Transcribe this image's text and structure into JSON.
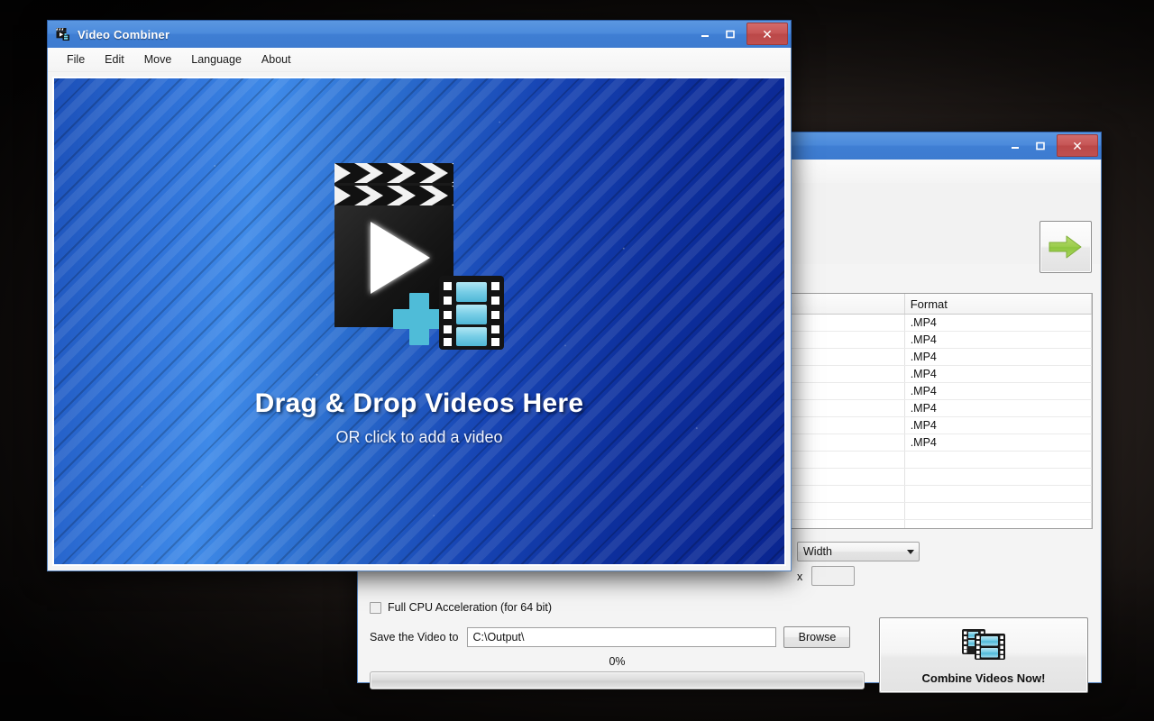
{
  "desktop": {
    "background_color": "#15110f"
  },
  "front_window": {
    "title": "Video Combiner",
    "app_icon": "film-clapper-icon",
    "controls": {
      "minimize": "minimize-icon",
      "maximize": "maximize-icon",
      "close": "close-icon"
    },
    "menu": [
      "File",
      "Edit",
      "Move",
      "Language",
      "About"
    ],
    "dropzone": {
      "heading": "Drag & Drop Videos Here",
      "subtext": "OR click to add a video",
      "icon": "video-clapper-plus-filmstrip-icon"
    }
  },
  "back_window": {
    "title": "",
    "controls": {
      "minimize": "minimize-icon",
      "maximize": "maximize-icon",
      "close": "close-icon"
    },
    "menu": [
      "",
      "",
      "",
      "",
      ""
    ],
    "next_button_icon": "green-right-arrow-icon",
    "table": {
      "columns": [
        "",
        "Format"
      ],
      "rows": [
        {
          "name": "",
          "format": ".MP4"
        },
        {
          "name": "",
          "format": ".MP4"
        },
        {
          "name": "",
          "format": ".MP4"
        },
        {
          "name": "",
          "format": ".MP4"
        },
        {
          "name": "",
          "format": ".MP4"
        },
        {
          "name": "",
          "format": ".MP4"
        },
        {
          "name": "",
          "format": ".MP4"
        },
        {
          "name": "",
          "format": ".MP4"
        },
        {
          "name": "",
          "format": ""
        },
        {
          "name": "",
          "format": ""
        },
        {
          "name": "",
          "format": ""
        },
        {
          "name": "",
          "format": ""
        },
        {
          "name": "",
          "format": ""
        }
      ]
    },
    "size": {
      "dropdown_value": "Width",
      "x_label": "x",
      "height_value": ""
    },
    "cpu_acceleration": {
      "label": "Full CPU Acceleration (for 64 bit)",
      "checked": false
    },
    "save": {
      "label": "Save the Video to",
      "path": "C:\\Output\\",
      "browse_label": "Browse"
    },
    "progress": {
      "percent_label": "0%",
      "value": 0
    },
    "combine_button": {
      "label": "Combine Videos Now!",
      "icon": "filmstrip-stack-icon"
    }
  }
}
